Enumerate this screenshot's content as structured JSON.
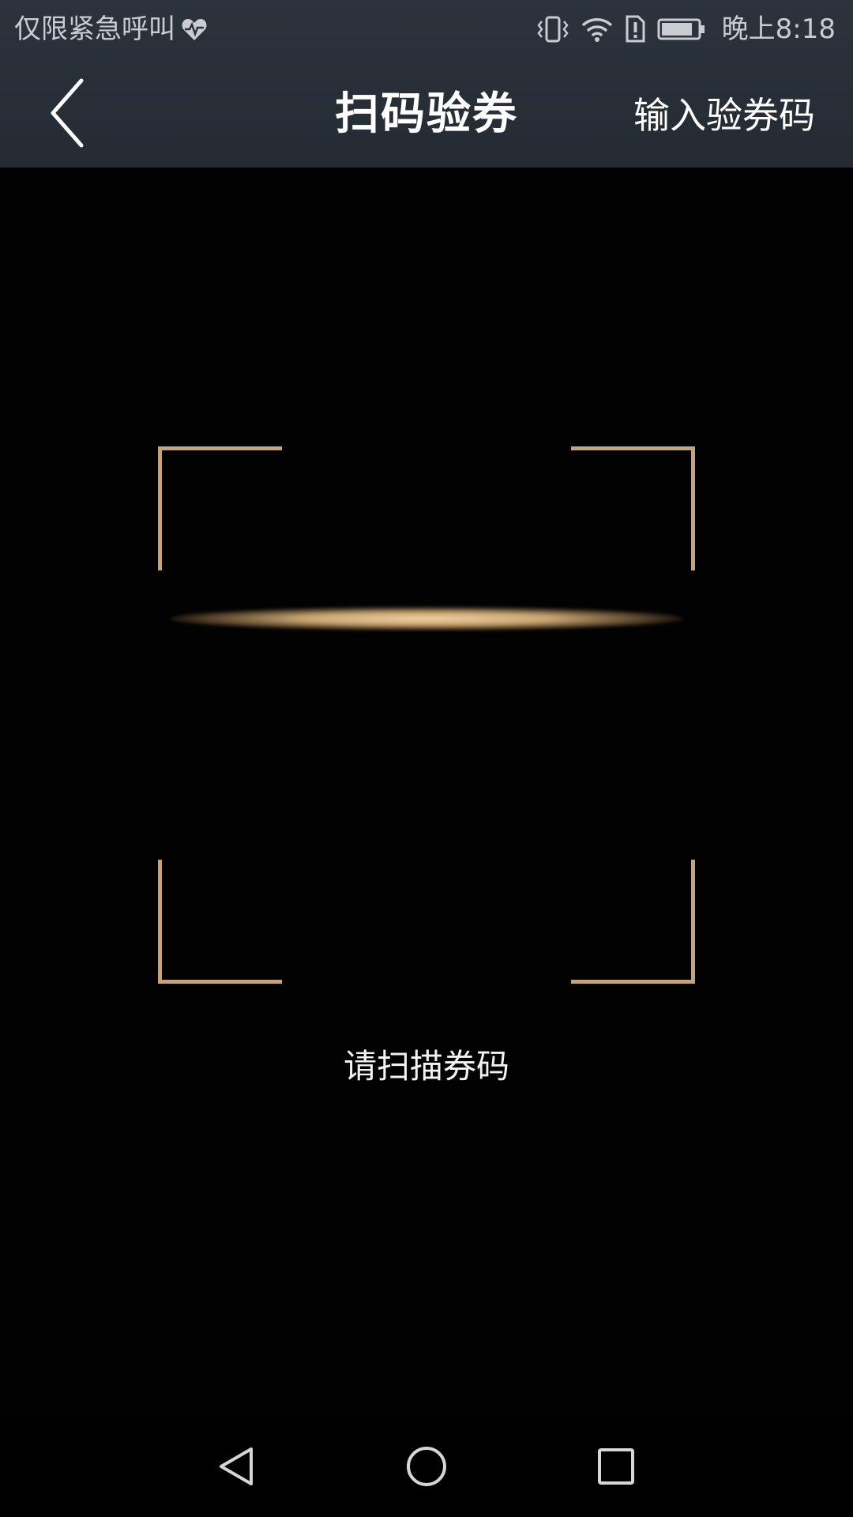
{
  "status_bar": {
    "carrier_text": "仅限紧急呼叫",
    "time": "晚上8:18",
    "icons": [
      "heart-health-icon",
      "vibrate-icon",
      "wifi-icon",
      "sim-alert-icon",
      "battery-icon"
    ],
    "icon_color": "#c9ccd2"
  },
  "nav_bar": {
    "title": "扫码验券",
    "right_action": "输入验券码",
    "back_icon": "chevron-left-icon",
    "background": "#2a3038"
  },
  "scanner": {
    "hint": "请扫描券码",
    "frame_color": "#c4a479",
    "line_color": "#d9b889"
  },
  "system_nav": {
    "buttons": [
      "back-triangle-icon",
      "home-circle-icon",
      "recents-square-icon"
    ]
  }
}
